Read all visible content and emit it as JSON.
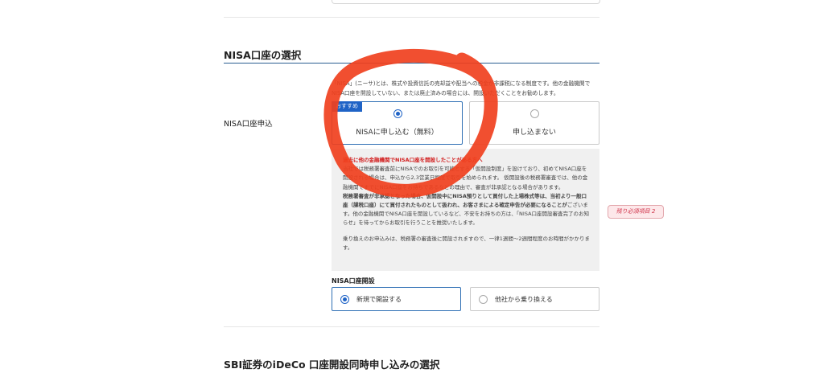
{
  "nisa_section": {
    "title": "NISA口座の選択",
    "intro": "「NISA」(ニーサ)とは、株式や投資信託の売却益や配当への税金が非課税になる制度です。他の金融機関でNISA口座を開設していない、または廃止済みの場合には、開設いただくことをお勧めします。",
    "field_label": "NISA口座申込",
    "options": [
      {
        "label": "NISAに申し込む（無料）",
        "badge": "おすすめ",
        "selected": true
      },
      {
        "label": "申し込まない",
        "selected": false
      }
    ],
    "notice": {
      "heading": "過去に他の金融機関でNISA口座を開設したことがある方へ",
      "paragraph1": "当社では税務署審査前にNISAでのお取引を可能とする「仮開設制度」を設けており、初めてNISA口座を開設される場合は、申込から2,3営業日程度で取引を始められます。 仮開設後の税務署審査では、他の金融機関ですでにNISA口座をお持ちであるなどの理由で、審査が非承認となる場合があります。",
      "paragraph2_bold": "税務署審査が非承認となった場合、仮開設中にNISA預りとして買付した上場株式等は、当初より一般口座（課税口座）にて買付されたものとして扱われ、お客さまによる確定申告が必要になることが",
      "paragraph2_rest": "ございます。他の金融機関でNISA口座を開設しているなど、不安をお持ちの方は、「NISA口座開設審査完了のお知らせ」を待ってからお取引を行うことを推奨いたします。",
      "paragraph3": "乗り換えのお申込みは、税務署の審査後に開設されますので、一律1週間〜2週間程度のお時間がかかります。"
    },
    "remaining_required": "残り必須項目 2",
    "opening": {
      "label": "NISA口座開設",
      "options": [
        {
          "label": "新規で開設する",
          "selected": true
        },
        {
          "label": "他社から乗り換える",
          "selected": false
        }
      ]
    }
  },
  "ideco_section": {
    "title": "SBI証券のiDeCo 口座開設同時申し込みの選択"
  },
  "colors": {
    "accent": "#1f63c6",
    "title_rule": "#2b5e91",
    "notice_red": "#d11a1a",
    "annotation": "#f0401e"
  }
}
